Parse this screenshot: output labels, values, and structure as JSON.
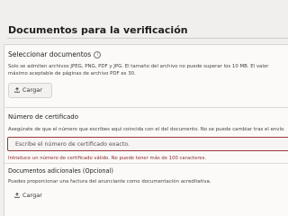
{
  "page": {
    "title": "Documentos para la verificación"
  },
  "documents": {
    "label": "Seleccionar documentos",
    "help_icon": "info-icon",
    "help": "Solo se admiten archivos JPEG, PNG, PDF y JPG. El tamaño del archivo no puede superar los 10 MB. El valor máximo aceptable de páginas de archivo PDF es 30.",
    "upload_label": "Cargar",
    "upload_icon": "upload-icon"
  },
  "certificate": {
    "label": "Número de certificado",
    "help": "Asegúrate de que el número que escribes aquí coincida con el del documento. No se puede cambiar tras el envío.",
    "placeholder": "Escribe el número de certificado exacto.",
    "error": "Introduce un número de certificado válido. No puede tener más de 100 caracteres."
  },
  "additional": {
    "label": "Documentos adicionales (Opcional)",
    "help": "Puedes proporcionar una factura del anunciante como documentación acreditativa.",
    "upload_label": "Cargar",
    "upload_icon": "upload-icon"
  },
  "colors": {
    "error": "#9c3a3a",
    "background": "#f1efed"
  }
}
